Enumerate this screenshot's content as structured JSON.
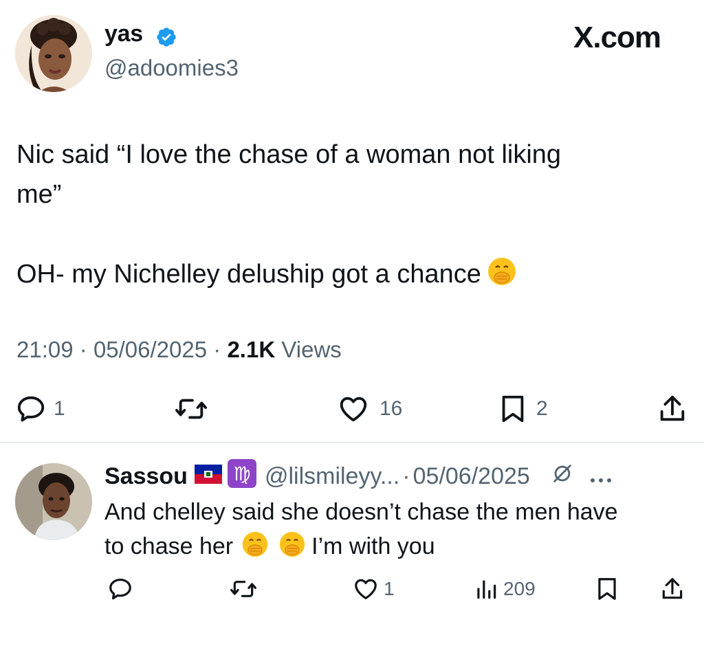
{
  "tweet": {
    "author_name": "yas",
    "author_handle": "@adoomies3",
    "brand": "X.com",
    "text_line1": "Nic said “I love the chase of a woman not liking",
    "text_line2": "me”",
    "text_line3": "OH- my Nichelley deluship got a chance",
    "time": "21:09",
    "sep1": "·",
    "date": "05/06/2025",
    "sep2": "·",
    "views_count": "2.1K",
    "views_label": "Views",
    "replies": "1",
    "likes": "16",
    "bookmarks": "2"
  },
  "reply": {
    "author_name": "Sassou",
    "author_handle": "@lilsmileyy...",
    "sep": "·",
    "date": "05/06/2025",
    "text_line1": "And chelley said she doesn’t chase the men have",
    "text_line2a": "to chase her",
    "text_line2b": "I’m with you",
    "likes": "1",
    "views": "209"
  },
  "colors": {
    "text": "#0f1419",
    "muted": "#536471",
    "verified": "#1d9bf0",
    "divider": "#cfd9de"
  },
  "icons": [
    "verified-badge-icon",
    "reply-icon",
    "retweet-icon",
    "like-icon",
    "bookmark-icon",
    "share-icon",
    "views-icon",
    "more-icon",
    "grok-icon",
    "haiti-flag-icon",
    "virgo-icon",
    "hand-over-mouth-emoji"
  ]
}
